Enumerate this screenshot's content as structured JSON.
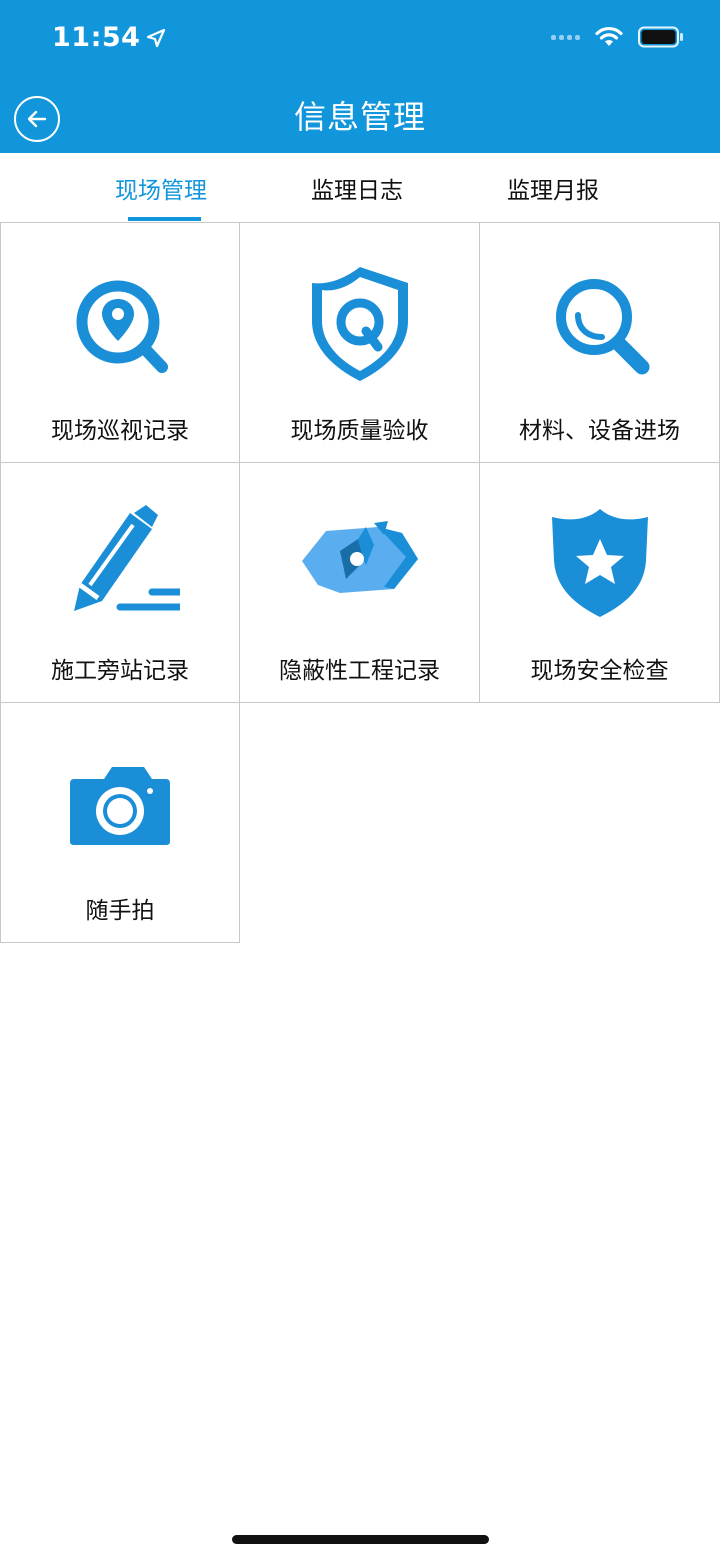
{
  "status_bar": {
    "time": "11:54"
  },
  "header": {
    "title": "信息管理"
  },
  "tabs": [
    {
      "label": "现场管理",
      "active": true
    },
    {
      "label": "监理日志",
      "active": false
    },
    {
      "label": "监理月报",
      "active": false
    }
  ],
  "grid_items": [
    {
      "label": "现场巡视记录",
      "icon": "location-search-icon"
    },
    {
      "label": "现场质量验收",
      "icon": "shield-q-icon"
    },
    {
      "label": "材料、设备进场",
      "icon": "magnifier-icon"
    },
    {
      "label": "施工旁站记录",
      "icon": "pencil-icon"
    },
    {
      "label": "隐蔽性工程记录",
      "icon": "broken-block-icon"
    },
    {
      "label": "现场安全检查",
      "icon": "shield-star-icon"
    },
    {
      "label": "随手拍",
      "icon": "camera-icon"
    }
  ],
  "colors": {
    "brand": "#1296db",
    "icon_blue": "#1a8fd8"
  }
}
